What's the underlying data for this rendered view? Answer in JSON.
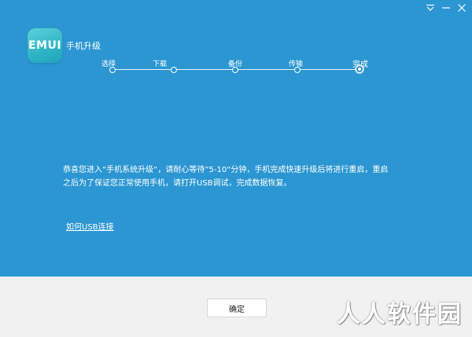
{
  "app": {
    "logo_text": "EMUI",
    "title": "手机升级"
  },
  "steps": [
    {
      "label": "选择",
      "state": "done"
    },
    {
      "label": "下载",
      "state": "done"
    },
    {
      "label": "备份",
      "state": "done"
    },
    {
      "label": "传输",
      "state": "done"
    },
    {
      "label": "完成",
      "state": "active"
    }
  ],
  "message": {
    "line1": "恭喜您进入“手机系统升级“，请耐心等待”5-10“分钟，手机完成快速升级后将进行重启，重启",
    "line2": "之后为了保证您正常使用手机，请打开USB调试，完成数据恢复。"
  },
  "help_link": "如何USB连接",
  "footer": {
    "ok_label": "确定"
  },
  "watermark": "人人软件园",
  "colors": {
    "background": "#2b96d2",
    "footer": "#f1f1f1",
    "logo": "#36b8c8"
  },
  "icons": {
    "dropdown": "chevron-down-icon",
    "minimize": "minimize-icon",
    "close": "close-icon"
  }
}
